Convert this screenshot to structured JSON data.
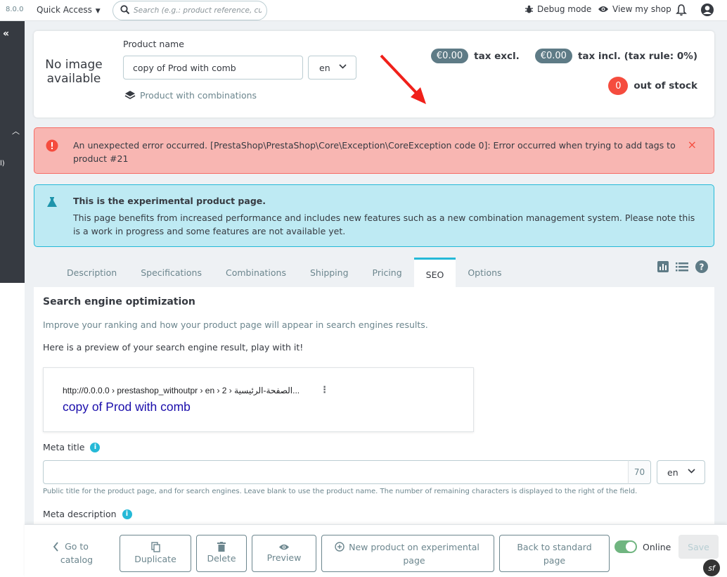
{
  "topbar": {
    "version": "8.0.0",
    "quick_access": "Quick Access",
    "search_placeholder": "Search (e.g.: product reference, custon",
    "debug_mode": "Debug mode",
    "view_shop": "View my shop"
  },
  "leftnav": {
    "collapse": "«",
    "fragment": "l)"
  },
  "header": {
    "no_image": "No image available",
    "product_name_label": "Product name",
    "product_name_value": "copy of Prod with comb",
    "language": "en",
    "product_type": "Product with combinations",
    "price_excl": "€0.00",
    "tax_excl_label": "tax excl.",
    "price_incl": "€0.00",
    "tax_incl_label": "tax incl. (tax rule: 0%)",
    "stock_count": "0",
    "stock_label": "out of stock"
  },
  "error_alert": {
    "text": "An unexpected error occurred. [PrestaShop\\PrestaShop\\Core\\Exception\\CoreException code 0]: Error occurred when trying to add tags to product #21",
    "close": "×"
  },
  "info_alert": {
    "title": "This is the experimental product page.",
    "text": "This page benefits from increased performance and includes new features such as a new combination management system. Please note this is a work in progress and some features are not available yet."
  },
  "tabs": [
    {
      "label": "Description"
    },
    {
      "label": "Specifications"
    },
    {
      "label": "Combinations"
    },
    {
      "label": "Shipping"
    },
    {
      "label": "Pricing"
    },
    {
      "label": "SEO"
    },
    {
      "label": "Options"
    }
  ],
  "seo": {
    "title": "Search engine optimization",
    "subtitle": "Improve your ranking and how your product page will appear in search engines results.",
    "preview_intro": "Here is a preview of your search engine result, play with it!",
    "preview_url": "http://0.0.0.0 › prestashop_withoutpr › en › 2 › الصفحة-الرئيسية...",
    "preview_title": "copy of Prod with comb",
    "meta_title_label": "Meta title",
    "meta_title_value": "",
    "meta_title_counter": "70",
    "meta_title_lang": "en",
    "meta_title_help": "Public title for the product page, and for search engines. Leave blank to use the product name. The number of remaining characters is displayed to the right of the field.",
    "meta_description_label": "Meta description"
  },
  "footer": {
    "go_to_catalog": "Go to catalog",
    "duplicate": "Duplicate",
    "delete": "Delete",
    "preview": "Preview",
    "new_product": "New product on experimental page",
    "back_standard": "Back to standard page",
    "online": "Online",
    "save": "Save",
    "sf_badge": "sf"
  },
  "colors": {
    "accent": "#25b9d7",
    "danger": "#f54c3e",
    "success": "#70b580"
  }
}
